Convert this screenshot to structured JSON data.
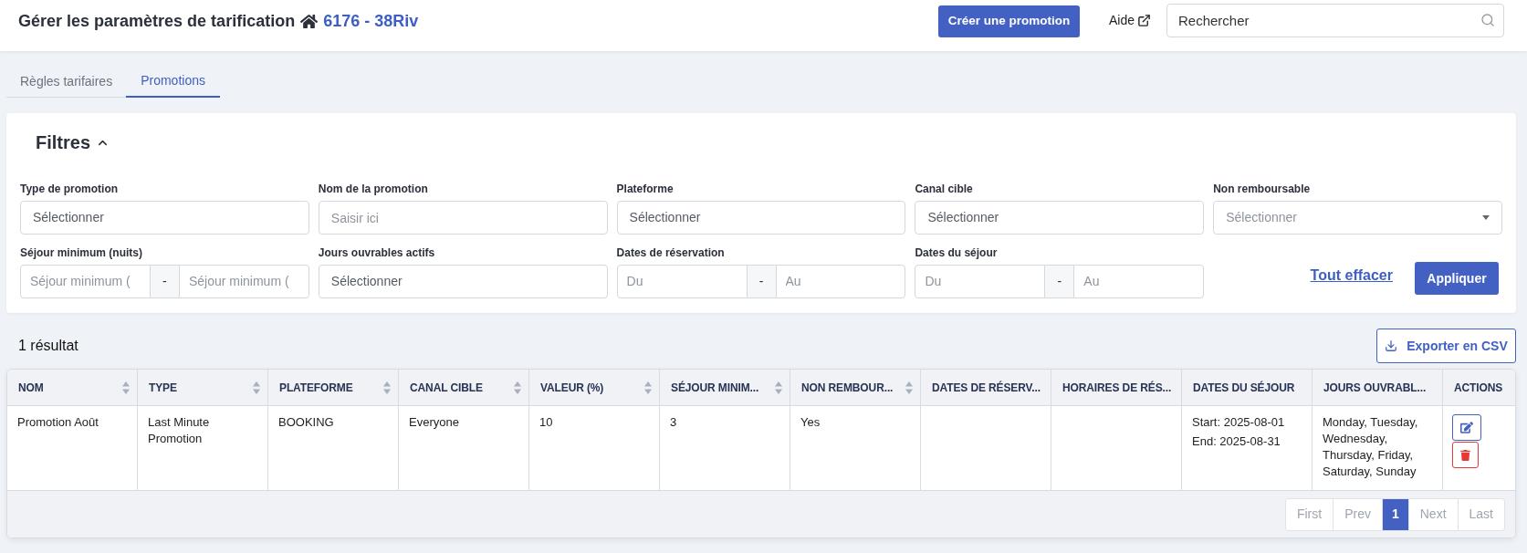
{
  "header": {
    "title": "Gérer les paramètres de tarification",
    "property": "6176 - 38Riv",
    "create_button": "Créer une promotion",
    "help_link": "Aide",
    "search": {
      "placeholder": "Rechercher"
    }
  },
  "tabs": [
    {
      "label": "Règles tarifaires",
      "selected": false
    },
    {
      "label": "Promotions",
      "selected": true
    }
  ],
  "filters": {
    "title": "Filtres",
    "expanded": true,
    "fields": [
      {
        "label": "Type de promotion",
        "kind": "select",
        "placeholder": "Sélectionner"
      },
      {
        "label": "Nom de la promotion",
        "kind": "text",
        "placeholder": "Saisir ici"
      },
      {
        "label": "Plateforme",
        "kind": "select",
        "placeholder": "Sélectionner"
      },
      {
        "label": "Canal cible",
        "kind": "select",
        "placeholder": "Sélectionner"
      },
      {
        "label": "Non remboursable",
        "kind": "dropdown",
        "placeholder": "Sélectionner"
      },
      {
        "label": "Séjour minimum (nuits)",
        "kind": "range",
        "from_placeholder": "Séjour minimum (",
        "separator": "-",
        "to_placeholder": "Séjour minimum ("
      },
      {
        "label": "Jours ouvrables actifs",
        "kind": "select",
        "placeholder": "Sélectionner"
      },
      {
        "label": "Dates de réservation",
        "kind": "range",
        "from_placeholder": "Du",
        "separator": "-",
        "to_placeholder": "Au"
      },
      {
        "label": "Dates du séjour",
        "kind": "range",
        "from_placeholder": "Du",
        "separator": "-",
        "to_placeholder": "Au"
      }
    ],
    "clear_link": "Tout effacer",
    "apply_button": "Appliquer"
  },
  "results": {
    "count": "1 résultat",
    "export_button": "Exporter en CSV"
  },
  "table": {
    "columns": [
      {
        "label": "NOM",
        "sortable": true
      },
      {
        "label": "TYPE",
        "sortable": true
      },
      {
        "label": "PLATEFORME",
        "sortable": true
      },
      {
        "label": "CANAL CIBLE",
        "sortable": true
      },
      {
        "label": "VALEUR (%)",
        "sortable": true
      },
      {
        "label": "SÉJOUR MINIM...",
        "sortable": true
      },
      {
        "label": "NON REMBOUR...",
        "sortable": true
      },
      {
        "label": "DATES DE RÉSERV...",
        "sortable": false
      },
      {
        "label": "HORAIRES DE RÉS...",
        "sortable": false
      },
      {
        "label": "DATES DU SÉJOUR",
        "sortable": false
      },
      {
        "label": "JOURS OUVRABL...",
        "sortable": false
      },
      {
        "label": "ACTIONS",
        "sortable": false
      }
    ],
    "rows": [
      {
        "cells": [
          "Promotion Août",
          "Last Minute Promotion",
          "BOOKING",
          "Everyone",
          "10",
          "3",
          "Yes",
          null,
          null,
          [
            "Start: 2025-08-01",
            "End: 2025-08-31"
          ],
          "Monday, Tuesday, Wednesday, Thursday, Friday, Saturday, Sunday"
        ]
      }
    ]
  },
  "pagination": [
    {
      "label": "First",
      "selected": false,
      "disabled": true
    },
    {
      "label": "Prev",
      "selected": false,
      "disabled": true
    },
    {
      "label": "1",
      "selected": true,
      "disabled": false
    },
    {
      "label": "Next",
      "selected": false,
      "disabled": true
    },
    {
      "label": "Last",
      "selected": false,
      "disabled": true
    }
  ]
}
